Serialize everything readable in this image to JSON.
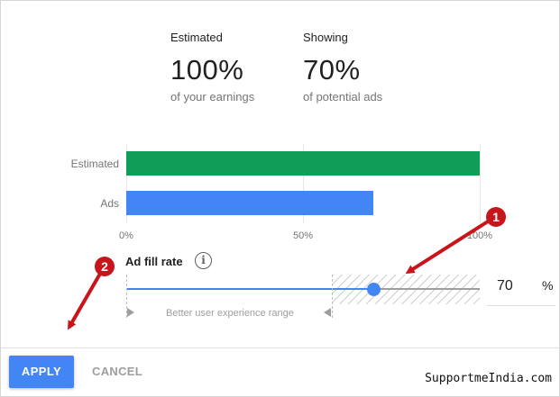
{
  "stats": [
    {
      "label": "Estimated",
      "value": "100%",
      "sub": "of your earnings"
    },
    {
      "label": "Showing",
      "value": "70%",
      "sub": "of potential ads"
    }
  ],
  "chart_data": {
    "type": "bar",
    "orientation": "horizontal",
    "categories": [
      "Estimated",
      "Ads"
    ],
    "values": [
      100,
      70
    ],
    "colors": [
      "#0f9d58",
      "#4285f4"
    ],
    "xlim": [
      0,
      100
    ],
    "ticks": [
      "0%",
      "50%",
      "100%"
    ],
    "grid": true
  },
  "fill_rate": {
    "title": "Ad fill rate",
    "info_icon": "info-icon",
    "value": 70,
    "value_text": "70",
    "unit": "%",
    "range_label": "Better user experience range"
  },
  "footer": {
    "apply_label": "APPLY",
    "cancel_label": "CANCEL",
    "watermark": "SupportmeIndia.com"
  },
  "annotations": {
    "badge_1": "1",
    "badge_2": "2",
    "color": "#c8141b"
  }
}
